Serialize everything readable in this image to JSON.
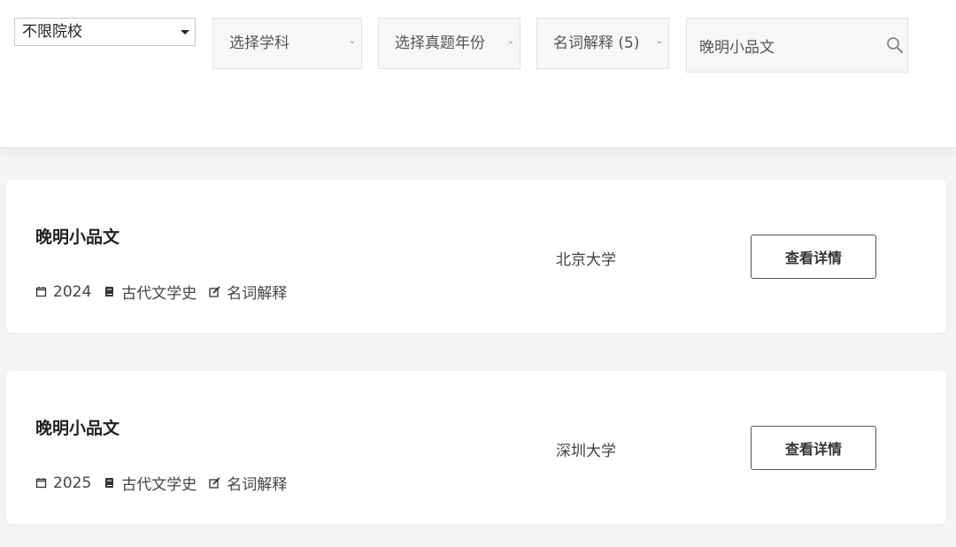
{
  "filters": {
    "school": "不限院校",
    "subject": "选择学科",
    "year": "选择真题年份",
    "type": "名词解释 (5)",
    "search_value": "晚明小品文"
  },
  "results": [
    {
      "title": "晚明小品文",
      "year": "2024",
      "subject": "古代文学史",
      "type": "名词解释",
      "school": "北京大学",
      "button": "查看详情"
    },
    {
      "title": "晚明小品文",
      "year": "2025",
      "subject": "古代文学史",
      "type": "名词解释",
      "school": "深圳大学",
      "button": "查看详情"
    }
  ],
  "icons": {
    "calendar": "calendar-icon",
    "book": "book-icon",
    "edit": "edit-icon",
    "search": "search-icon"
  }
}
